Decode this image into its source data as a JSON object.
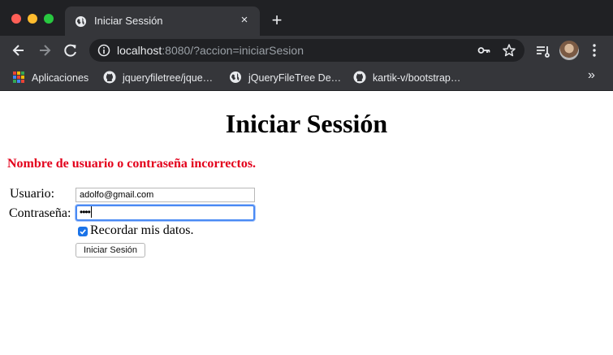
{
  "browser": {
    "tab": {
      "title": "Iniciar Sessión",
      "favicon": "globe-icon",
      "close": "×"
    },
    "new_tab": "+",
    "address": {
      "host": "localhost",
      "rest": ":8080/?accion=iniciarSesion"
    },
    "bookmarks": [
      {
        "label": "Aplicaciones",
        "icon": "apps-grid-icon"
      },
      {
        "label": "jqueryfiletree/jque…",
        "icon": "github-icon"
      },
      {
        "label": "jQueryFileTree De…",
        "icon": "globe-icon"
      },
      {
        "label": "kartik-v/bootstrap…",
        "icon": "github-icon"
      }
    ],
    "bookmarks_more": "»"
  },
  "page": {
    "title": "Iniciar Sessión",
    "error": "Nombre de usuario o contraseña incorrectos.",
    "username_label": "Usuario:",
    "username_value": "adolfo@gmail.com",
    "password_label": "Contraseña:",
    "password_value": "••••",
    "remember_label": "Recordar mis datos.",
    "remember_checked": true,
    "submit_label": "Iniciar Sesión"
  },
  "colors": {
    "error": "#e3001b",
    "focus": "#4a8af4",
    "chrome_dark": "#202124",
    "chrome_toolbar": "#35363a"
  }
}
